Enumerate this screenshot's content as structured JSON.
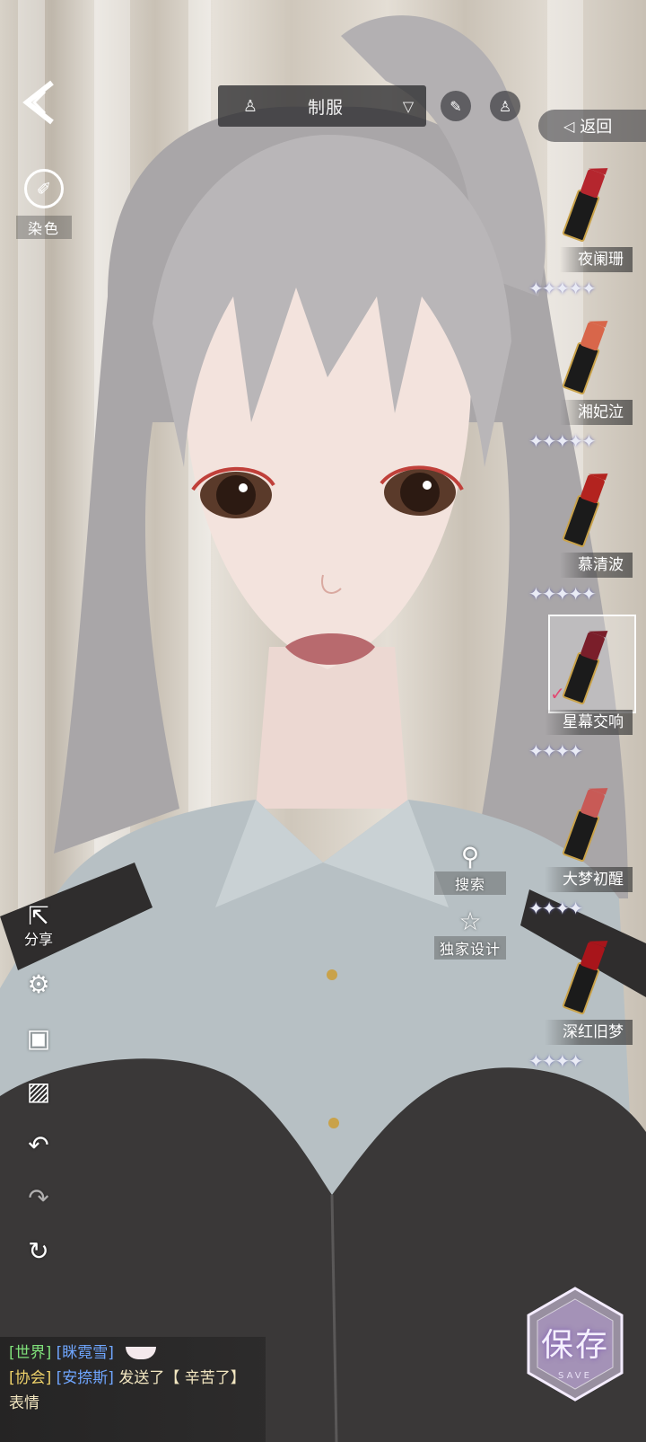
{
  "top_bar": {
    "outfit_label": "制服",
    "return_label": "返回"
  },
  "left_tools": {
    "dye_label": "染色",
    "share_label": "分享"
  },
  "lipsticks": [
    {
      "name": "夜阑珊",
      "stars": 5,
      "selected": false
    },
    {
      "name": "湘妃泣",
      "stars": 5,
      "selected": false
    },
    {
      "name": "慕清波",
      "stars": 5,
      "selected": false
    },
    {
      "name": "星幕交响",
      "stars": 4,
      "selected": true
    },
    {
      "name": "大梦初醒",
      "stars": 4,
      "selected": false
    },
    {
      "name": "深红旧梦",
      "stars": 4,
      "selected": false
    }
  ],
  "search_label": "搜索",
  "design_label": "独家设计",
  "chat": {
    "line1_channel": "[世界]",
    "line1_user": "[眯霓雪]",
    "line2_channel": "[协会]",
    "line2_user": "[安捺斯]",
    "line2_msg": "发送了【 辛苦了】表情"
  },
  "save": {
    "label": "保存",
    "sub": "SAVE"
  },
  "colors": {
    "star": "#e9ebf5",
    "chat_world": "#7fe07a",
    "chat_guild": "#f0d36a",
    "chat_user": "#6fa6ff"
  }
}
